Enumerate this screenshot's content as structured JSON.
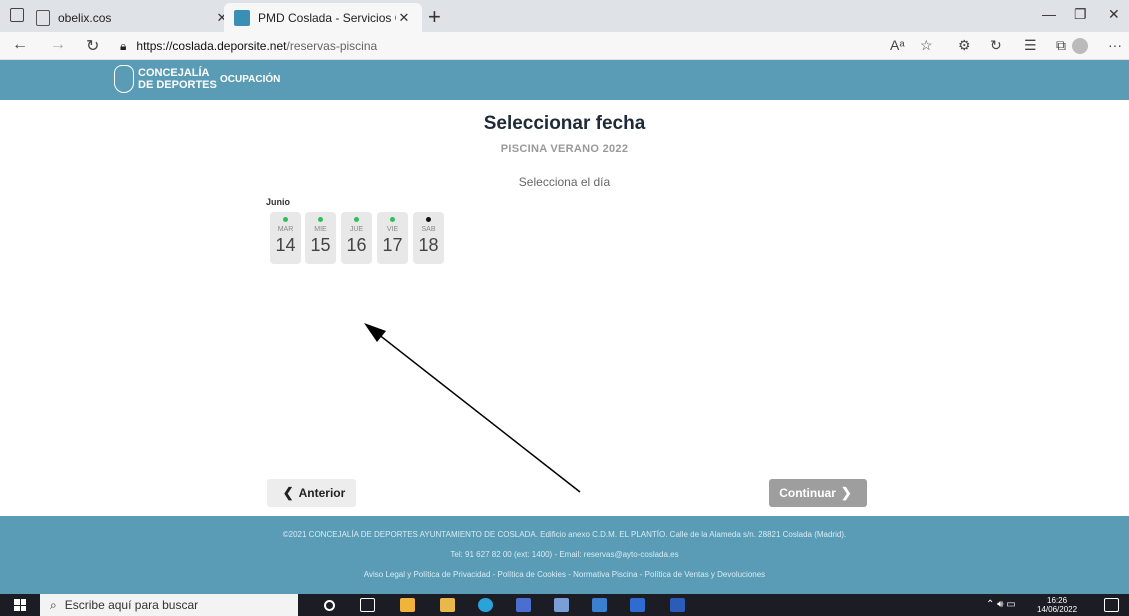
{
  "browser": {
    "tabs": [
      {
        "title": "obelix.cos",
        "active": false
      },
      {
        "title": "PMD Coslada - Servicios OnLine",
        "active": true
      }
    ],
    "url_host": "https://coslada.deporsite.net",
    "url_path": "/reservas-piscina",
    "new_tab_label": "+"
  },
  "header": {
    "logo_line1": "CONCEJALÍA",
    "logo_line2": "DE DEPORTES",
    "nav_item": "OCUPACIÓN"
  },
  "main": {
    "title": "Seleccionar fecha",
    "subtitle": "PISCINA VERANO 2022",
    "instruction": "Selecciona el día",
    "month": "Junio",
    "days": [
      {
        "name": "MAR",
        "num": "14",
        "dot_color": "#2fbf5a"
      },
      {
        "name": "MIE",
        "num": "15",
        "dot_color": "#2fbf5a"
      },
      {
        "name": "JUE",
        "num": "16",
        "dot_color": "#2fbf5a"
      },
      {
        "name": "VIE",
        "num": "17",
        "dot_color": "#2fbf5a"
      },
      {
        "name": "SAB",
        "num": "18",
        "dot_color": "#111111"
      }
    ],
    "prev_label": "Anterior",
    "next_label": "Continuar"
  },
  "footer": {
    "line1": "©2021 CONCEJALÍA DE DEPORTES AYUNTAMIENTO DE COSLADA. Edificio anexo C.D.M. EL PLANTÍO. Calle de la Alameda s/n. 28821 Coslada (Madrid).",
    "line2": "Tel: 91 627 82 00 (ext: 1400) - Email: reservas@ayto-coslada.es",
    "line3": "Aviso Legal y Política de Privacidad - Política de Cookies - Normativa Piscina - Política de Ventas y Devoluciones"
  },
  "taskbar": {
    "search_placeholder": "Escribe aquí para buscar",
    "time": "16:26",
    "date": "14/06/2022"
  },
  "colors": {
    "accent": "#5a9bb5",
    "available_dot": "#2fbf5a"
  }
}
